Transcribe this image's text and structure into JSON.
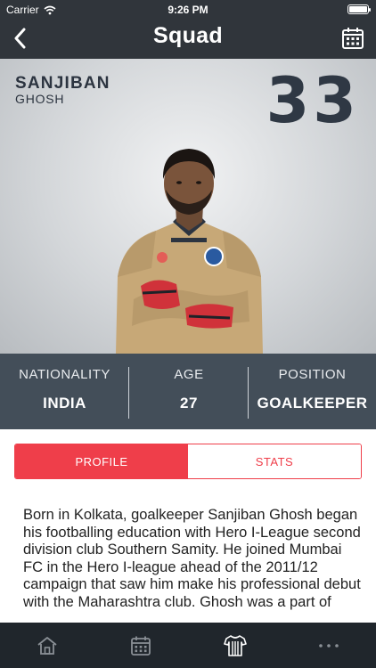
{
  "status_bar": {
    "carrier": "Carrier",
    "time": "9:26 PM",
    "battery_level": 1.0
  },
  "nav": {
    "title": "Squad",
    "back_icon": "chevron-left-icon",
    "calendar_icon": "calendar-icon"
  },
  "player": {
    "first_name": "SANJIBAN",
    "last_name": "GHOSH",
    "number": "33",
    "jersey_color": "#c7a877",
    "glove_color": "#d0323a"
  },
  "info": [
    {
      "label": "NATIONALITY",
      "value": "INDIA"
    },
    {
      "label": "AGE",
      "value": "27"
    },
    {
      "label": "POSITION",
      "value": "GOALKEEPER"
    }
  ],
  "tabs": [
    {
      "label": "PROFILE",
      "active": true
    },
    {
      "label": "STATS",
      "active": false
    }
  ],
  "bio": "Born in Kolkata, goalkeeper Sanjiban Ghosh began his footballing education with Hero I-League second division club Southern Samity. He joined Mumbai FC in the Hero I-league ahead of the 2011/12 campaign that saw him make his professional debut with the Maharashtra club. Ghosh was a part of",
  "tabbar": [
    {
      "icon": "home-icon"
    },
    {
      "icon": "calendar-icon"
    },
    {
      "icon": "jersey-icon",
      "active": true
    },
    {
      "icon": "more-icon"
    }
  ],
  "colors": {
    "accent": "#ef3e4a",
    "nav_bg": "#30353b",
    "info_bg": "#434e59",
    "tabbar_bg": "#20262c",
    "tabbar_icon": "#8a9096"
  }
}
